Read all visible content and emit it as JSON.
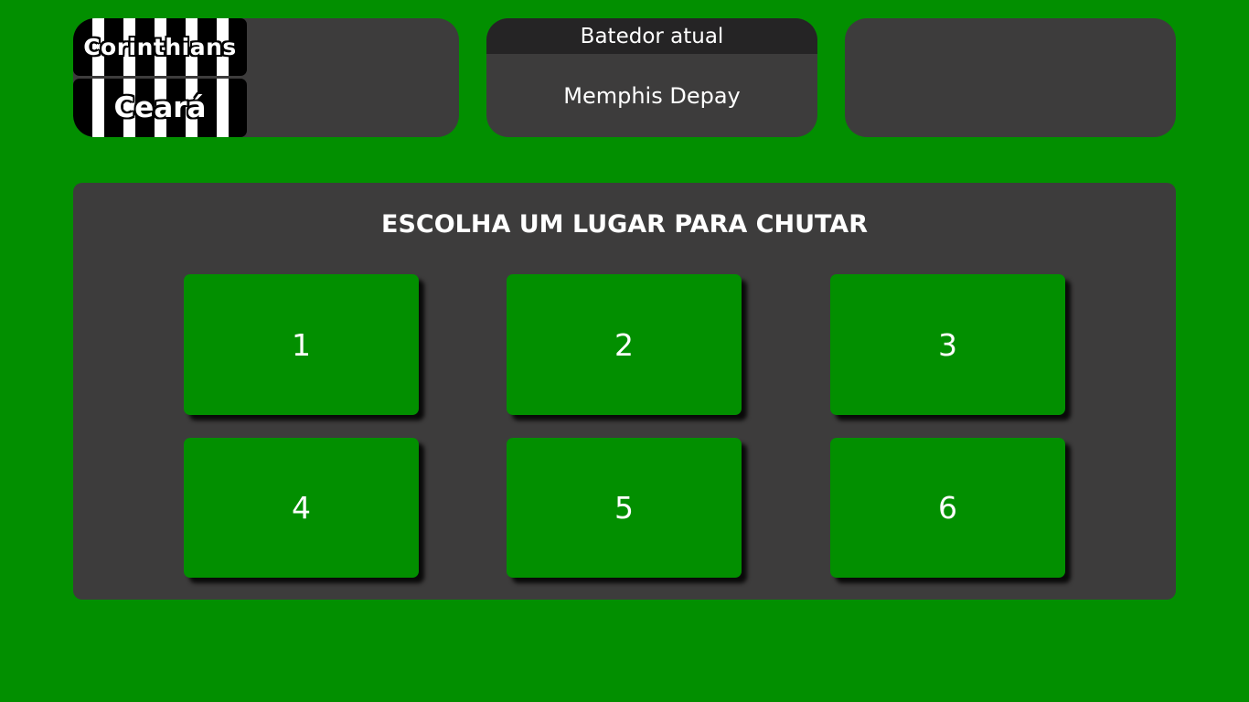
{
  "scoreboard": {
    "home_team": "Corinthians",
    "away_team": "Ceará"
  },
  "shooter": {
    "header": "Batedor atual",
    "name": "Memphis Depay"
  },
  "kick": {
    "title": "ESCOLHA UM LUGAR PARA CHUTAR",
    "options": [
      "1",
      "2",
      "3",
      "4",
      "5",
      "6"
    ]
  },
  "colors": {
    "field_green": "#028f00",
    "panel_gray": "#3d3c3c",
    "header_dark": "#252425",
    "text": "#ffffff"
  }
}
